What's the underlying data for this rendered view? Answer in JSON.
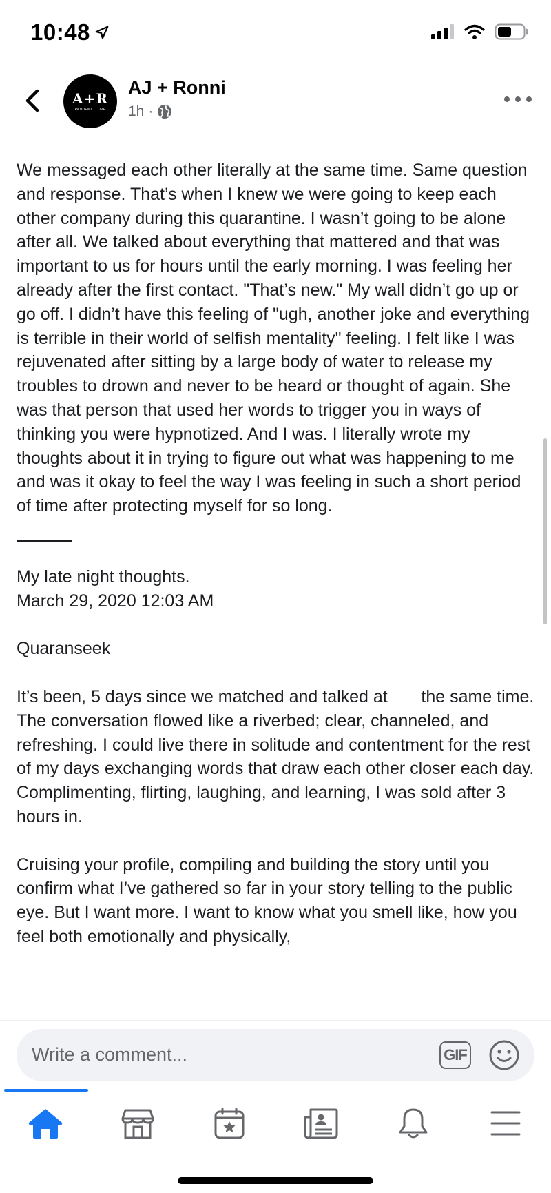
{
  "status_bar": {
    "time": "10:48",
    "icons": [
      "location-arrow-icon",
      "signal-bars-icon",
      "wifi-icon",
      "battery-icon"
    ]
  },
  "header": {
    "back_icon": "chevron-left-icon",
    "avatar": {
      "monogram": "A+R",
      "tagline": "PANDEMIC LOVE"
    },
    "page_name": "AJ + Ronni",
    "time_ago": "1h",
    "separator": "·",
    "privacy_icon": "globe-icon",
    "more_icon": "more-dots-icon"
  },
  "post": {
    "paragraph_1": "We messaged each other literally at the same time. Same question and response. That’s when I knew we were going to keep each other company during this quarantine. I wasn’t going to be alone after all. We talked about everything that mattered and that was important to us for hours until the early morning. I was feeling her already after the first contact. \"That’s new.\" My wall didn’t go up or go off. I didn’t have this feeling of \"ugh, another joke and everything is terrible in their world of selfish mentality\" feeling. I felt like I was rejuvenated after sitting by a large body of water to release my troubles to drown and never to be heard or thought of again. She was that person that used her words to trigger you in ways of thinking you were hypnotized. And I was. I literally wrote my thoughts about it in trying to figure out what was happening to me and was it okay to feel the way I was feeling in such a short period of time after protecting myself for so long.",
    "note_title": "My late night thoughts.",
    "note_date": "March 29, 2020 12:03 AM",
    "note_heading": "Quaranseek",
    "paragraph_2": "It’s been, 5 days since we matched and talked at       the same time. The conversation flowed like a riverbed; clear, channeled, and refreshing. I could live there in solitude and contentment for the rest of my days exchanging words that draw each other closer each day. Complimenting, flirting, laughing, and learning, I was sold after 3 hours in.",
    "paragraph_3": "Cruising your profile, compiling and building the story until you confirm what I’ve gathered so far in your story telling to the public eye. But I want more. I want to know what you smell like, how you feel both emotionally and physically,"
  },
  "comment_bar": {
    "placeholder": "Write a comment...",
    "gif_label": "GIF",
    "emoji_icon": "smiley-icon"
  },
  "tab_bar": {
    "active_tab": "home",
    "tabs": [
      {
        "id": "home",
        "icon": "home-icon"
      },
      {
        "id": "marketplace",
        "icon": "marketplace-icon"
      },
      {
        "id": "events",
        "icon": "calendar-star-icon"
      },
      {
        "id": "news",
        "icon": "news-icon"
      },
      {
        "id": "notifications",
        "icon": "bell-icon"
      },
      {
        "id": "menu",
        "icon": "menu-icon"
      }
    ]
  },
  "colors": {
    "accent": "#1877f2",
    "text_primary": "#050505",
    "text_secondary": "#65676b",
    "input_bg": "#f0f2f5"
  }
}
